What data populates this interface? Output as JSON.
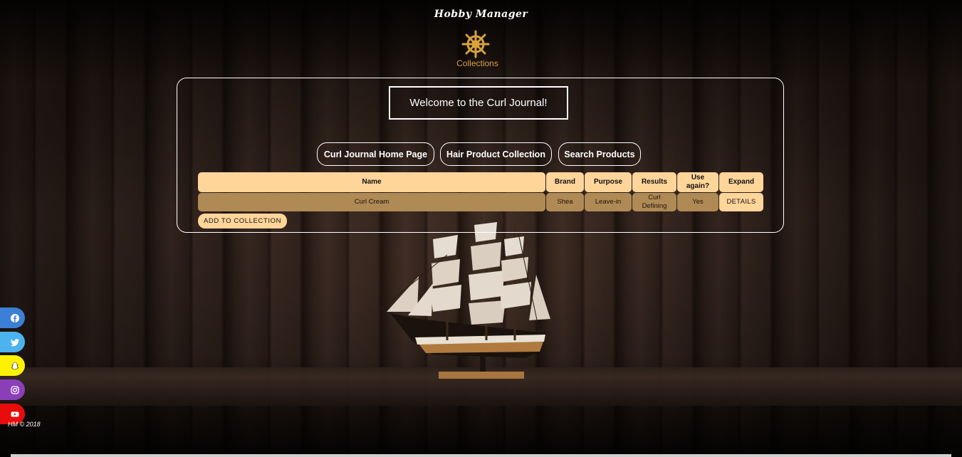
{
  "header": {
    "app_title": "Hobby Manager",
    "logo_icon": "ship-wheel-icon",
    "collections_link": "Collections"
  },
  "main": {
    "welcome_text": "Welcome to the Curl Journal!",
    "nav": [
      {
        "label": "Curl Journal Home Page"
      },
      {
        "label": "Hair Product Collection"
      },
      {
        "label": "Search Products"
      }
    ],
    "table": {
      "columns": [
        "Name",
        "Brand",
        "Purpose",
        "Results",
        "Use again?",
        "Expand"
      ],
      "rows": [
        {
          "name": "Curl Cream",
          "brand": "Shea",
          "purpose": "Leave-in",
          "results": "Curl Defining",
          "use_again": "Yes",
          "expand": "DETAILS"
        }
      ]
    },
    "add_button": "ADD TO COLLECTION"
  },
  "social": [
    {
      "name": "facebook-icon",
      "color": "#3b7fd6"
    },
    {
      "name": "twitter-icon",
      "color": "#4cb3ef"
    },
    {
      "name": "snapchat-icon",
      "color": "#fff200"
    },
    {
      "name": "instagram-icon",
      "color": "#8a3fb8"
    },
    {
      "name": "youtube-icon",
      "color": "#e80c0c"
    }
  ],
  "footer": {
    "copyright": "HM © 2018"
  },
  "colors": {
    "accent": "#ffd59a",
    "row_fill": "#b08a55",
    "link": "#d8a047"
  }
}
